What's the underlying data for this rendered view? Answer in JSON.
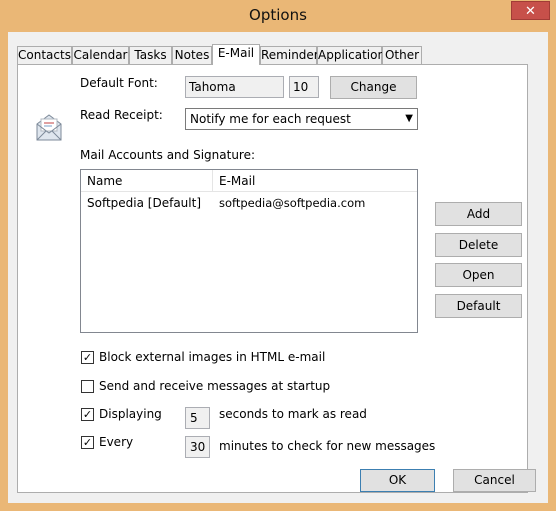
{
  "window": {
    "title": "Options",
    "close_glyph": "✕"
  },
  "tabs": [
    "Contacts",
    "Calendar",
    "Tasks",
    "Notes",
    "E-Mail",
    "Reminder",
    "Application",
    "Other"
  ],
  "active_tab": "E-Mail",
  "email": {
    "default_font_label": "Default Font:",
    "font_name": "Tahoma",
    "font_size": "10",
    "change_label": "Change",
    "read_receipt_label": "Read Receipt:",
    "read_receipt_value": "Notify me for each request",
    "accounts_label": "Mail Accounts and Signature:",
    "columns": [
      "Name",
      "E-Mail"
    ],
    "accounts": [
      {
        "name": "Softpedia [Default]",
        "email": "softpedia@softpedia.com"
      }
    ],
    "buttons": {
      "add": "Add",
      "delete": "Delete",
      "open": "Open",
      "default": "Default"
    },
    "block_images": {
      "label": "Block external images in HTML e-mail",
      "checked": true
    },
    "send_receive": {
      "label": "Send and receive messages at startup",
      "checked": false
    },
    "displaying": {
      "label": "Displaying",
      "checked": true,
      "value": "5",
      "suffix": "seconds to mark as read"
    },
    "every": {
      "label": "Every",
      "checked": true,
      "value": "30",
      "suffix": "minutes to check for new messages"
    },
    "check_glyph": "✓"
  },
  "footer": {
    "ok": "OK",
    "cancel": "Cancel"
  }
}
